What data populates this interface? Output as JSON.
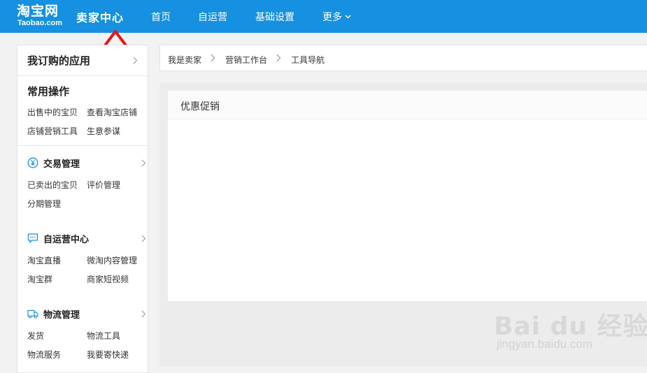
{
  "header": {
    "logo_cn": "淘宝网",
    "logo_en": "Taobao.com",
    "brand": "卖家中心",
    "nav": [
      "首页",
      "自运营",
      "基础设置",
      "更多"
    ],
    "bg_color": "#1690e0"
  },
  "sidebar": {
    "apps_title": "我订购的应用",
    "common_title": "常用操作",
    "common_links": [
      "出售中的宝贝",
      "查看淘宝店铺",
      "店铺营销工具",
      "生意参谋"
    ],
    "groups": [
      {
        "title": "交易管理",
        "icon": "yen-circle-icon",
        "links": [
          "已卖出的宝贝",
          "评价管理",
          "分期管理"
        ]
      },
      {
        "title": "自运营中心",
        "icon": "chat-bubble-icon",
        "links": [
          "淘宝直播",
          "微淘内容管理",
          "淘宝群",
          "商家短视频"
        ]
      },
      {
        "title": "物流管理",
        "icon": "truck-icon",
        "links": [
          "发货",
          "物流工具",
          "物流服务",
          "我要寄快递"
        ]
      }
    ]
  },
  "breadcrumb": [
    "我是卖家",
    "营销工作台",
    "工具导航"
  ],
  "content": {
    "card_title": "优惠促销"
  },
  "watermark": {
    "main": "Bai du 经验",
    "sub": "jingyan.baidu.com"
  },
  "annotation": {
    "arrow_color": "#e8141c"
  }
}
